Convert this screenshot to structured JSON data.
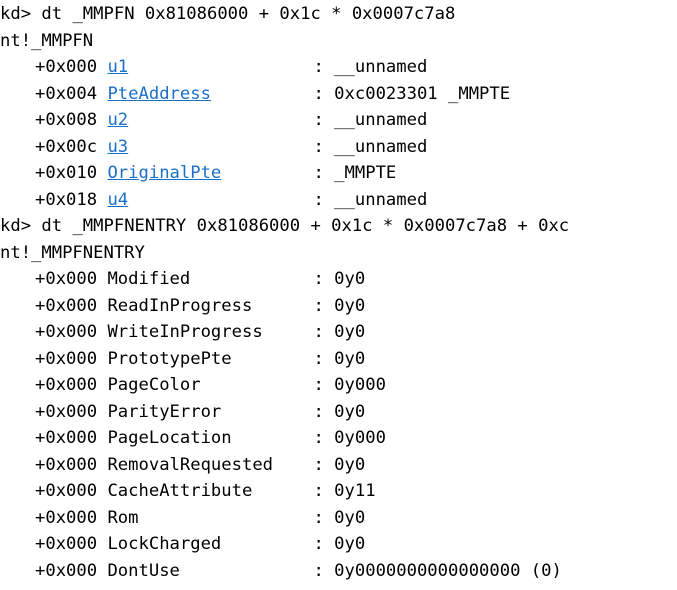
{
  "commands": [
    {
      "prompt": "kd>",
      "text": "dt _MMPFN 0x81086000 + 0x1c * 0x0007c7a8",
      "type_name": "nt!_MMPFN",
      "fields": [
        {
          "offset": "+0x000",
          "name": "u1",
          "link": true,
          "value": "__unnamed"
        },
        {
          "offset": "+0x004",
          "name": "PteAddress",
          "link": true,
          "value": "0xc0023301 _MMPTE"
        },
        {
          "offset": "+0x008",
          "name": "u2",
          "link": true,
          "value": "__unnamed"
        },
        {
          "offset": "+0x00c",
          "name": "u3",
          "link": true,
          "value": "__unnamed"
        },
        {
          "offset": "+0x010",
          "name": "OriginalPte",
          "link": true,
          "value": "_MMPTE"
        },
        {
          "offset": "+0x018",
          "name": "u4",
          "link": true,
          "value": "__unnamed"
        }
      ]
    },
    {
      "prompt": "kd>",
      "text": "dt _MMPFNENTRY 0x81086000 + 0x1c * 0x0007c7a8 + 0xc",
      "type_name": "nt!_MMPFNENTRY",
      "fields": [
        {
          "offset": "+0x000",
          "name": "Modified",
          "link": false,
          "value": "0y0"
        },
        {
          "offset": "+0x000",
          "name": "ReadInProgress",
          "link": false,
          "value": "0y0"
        },
        {
          "offset": "+0x000",
          "name": "WriteInProgress",
          "link": false,
          "value": "0y0"
        },
        {
          "offset": "+0x000",
          "name": "PrototypePte",
          "link": false,
          "value": "0y0"
        },
        {
          "offset": "+0x000",
          "name": "PageColor",
          "link": false,
          "value": "0y000"
        },
        {
          "offset": "+0x000",
          "name": "ParityError",
          "link": false,
          "value": "0y0"
        },
        {
          "offset": "+0x000",
          "name": "PageLocation",
          "link": false,
          "value": "0y000"
        },
        {
          "offset": "+0x000",
          "name": "RemovalRequested",
          "link": false,
          "value": "0y0"
        },
        {
          "offset": "+0x000",
          "name": "CacheAttribute",
          "link": false,
          "value": "0y11"
        },
        {
          "offset": "+0x000",
          "name": "Rom",
          "link": false,
          "value": "0y0"
        },
        {
          "offset": "+0x000",
          "name": "LockCharged",
          "link": false,
          "value": "0y0"
        },
        {
          "offset": "+0x000",
          "name": "DontUse",
          "link": false,
          "value": "0y0000000000000000 (0)"
        }
      ]
    }
  ],
  "separator": ":",
  "colors": {
    "background": "#ffffff",
    "text": "#000000",
    "link": "#1a6fc9"
  }
}
